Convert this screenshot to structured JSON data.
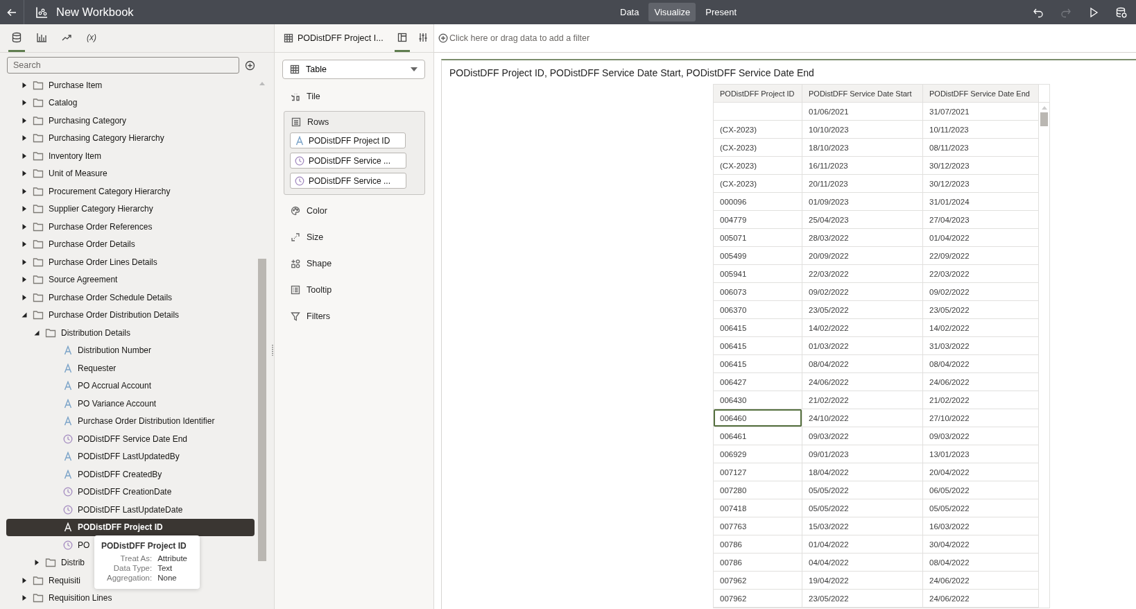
{
  "topbar": {
    "title": "New Workbook",
    "tabs": [
      {
        "label": "Data",
        "selected": false
      },
      {
        "label": "Visualize",
        "selected": true
      },
      {
        "label": "Present",
        "selected": false
      }
    ],
    "actions": [
      {
        "kind": "undo",
        "disabled": false
      },
      {
        "kind": "redo",
        "disabled": true
      },
      {
        "kind": "play",
        "disabled": false
      },
      {
        "kind": "save",
        "disabled": false
      }
    ]
  },
  "data_panel": {
    "tabs": [
      {
        "kind": "data",
        "selected": true
      },
      {
        "kind": "visualizations",
        "selected": false
      },
      {
        "kind": "analytics",
        "selected": false
      },
      {
        "kind": "calculations",
        "label": "(x)",
        "selected": false
      }
    ],
    "search": {
      "placeholder": "Search"
    },
    "tree": [
      {
        "label": "Purchase Item",
        "kind": "folder",
        "expanded": false,
        "selected": false
      },
      {
        "label": "Catalog",
        "kind": "folder",
        "expanded": false,
        "selected": false
      },
      {
        "label": "Purchasing Category",
        "kind": "folder",
        "expanded": false,
        "selected": false
      },
      {
        "label": "Purchasing Category Hierarchy",
        "kind": "folder",
        "expanded": false,
        "selected": false
      },
      {
        "label": "Inventory Item",
        "kind": "folder",
        "expanded": false,
        "selected": false
      },
      {
        "label": "Unit of Measure",
        "kind": "folder",
        "expanded": false,
        "selected": false
      },
      {
        "label": "Procurement Category Hierarchy",
        "kind": "folder",
        "expanded": false,
        "selected": false
      },
      {
        "label": "Supplier Category Hierarchy",
        "kind": "folder",
        "expanded": false,
        "selected": false
      },
      {
        "label": "Purchase Order References",
        "kind": "folder",
        "expanded": false,
        "selected": false
      },
      {
        "label": "Purchase Order Details",
        "kind": "folder",
        "expanded": false,
        "selected": false
      },
      {
        "label": "Purchase Order Lines Details",
        "kind": "folder",
        "expanded": false,
        "selected": false
      },
      {
        "label": "Source Agreement",
        "kind": "folder",
        "expanded": false,
        "selected": false
      },
      {
        "label": "Purchase Order Schedule Details",
        "kind": "folder",
        "expanded": false,
        "selected": false
      },
      {
        "label": "Purchase Order Distribution Details",
        "kind": "folder",
        "expanded": true,
        "selected": false,
        "children": [
          {
            "label": "Distribution Details",
            "kind": "folder",
            "expanded": true,
            "selected": false,
            "children": [
              {
                "label": "Distribution Number",
                "kind": "attribute",
                "selected": false
              },
              {
                "label": "Requester",
                "kind": "attribute",
                "selected": false
              },
              {
                "label": "PO Accrual Account",
                "kind": "attribute",
                "selected": false
              },
              {
                "label": "PO Variance Account",
                "kind": "attribute",
                "selected": false
              },
              {
                "label": "Purchase Order Distribution Identifier",
                "kind": "attribute",
                "selected": false
              },
              {
                "label": "PODistDFF Service Date End",
                "kind": "date",
                "selected": false
              },
              {
                "label": "PODistDFF LastUpdatedBy",
                "kind": "attribute",
                "selected": false
              },
              {
                "label": "PODistDFF CreatedBy",
                "kind": "attribute",
                "selected": false
              },
              {
                "label": "PODistDFF CreationDate",
                "kind": "date",
                "selected": false
              },
              {
                "label": "PODistDFF LastUpdateDate",
                "kind": "date",
                "selected": false
              },
              {
                "label": "PODistDFF Project ID",
                "kind": "attribute",
                "selected": true
              },
              {
                "label": "PO",
                "kind": "date",
                "selected": false
              }
            ]
          },
          {
            "label": "Distrib",
            "kind": "folder",
            "expanded": false,
            "selected": false
          }
        ]
      },
      {
        "label": "Requisiti",
        "kind": "folder",
        "expanded": false,
        "selected": false
      },
      {
        "label": "Requisition Lines",
        "kind": "folder",
        "expanded": false,
        "selected": false
      }
    ],
    "tooltip": {
      "title": "PODistDFF Project ID",
      "fields": [
        {
          "label": "Treat As:",
          "value": "Attribute"
        },
        {
          "label": "Data Type:",
          "value": "Text"
        },
        {
          "label": "Aggregation:",
          "value": "None"
        }
      ]
    }
  },
  "grammar_panel": {
    "title": "PODistDFF Project I...",
    "tabs": [
      {
        "kind": "grammar",
        "selected": true
      },
      {
        "kind": "properties",
        "selected": false
      }
    ],
    "viz_type": "Table",
    "sections": [
      {
        "kind": "tile",
        "label": "Tile"
      },
      {
        "kind": "rows",
        "label": "Rows",
        "items": [
          {
            "label": "PODistDFF Project ID",
            "kind": "attribute"
          },
          {
            "label": "PODistDFF Service ...",
            "kind": "date"
          },
          {
            "label": "PODistDFF Service ...",
            "kind": "date"
          }
        ]
      },
      {
        "kind": "color",
        "label": "Color"
      },
      {
        "kind": "size",
        "label": "Size"
      },
      {
        "kind": "shape",
        "label": "Shape"
      },
      {
        "kind": "tooltip",
        "label": "Tooltip"
      },
      {
        "kind": "filters",
        "label": "Filters"
      }
    ]
  },
  "filter_bar": {
    "placeholder": "Click here or drag data to add a filter"
  },
  "canvas": {
    "title": "PODistDFF Project ID, PODistDFF Service Date Start, PODistDFF Service Date End",
    "table": {
      "columns": [
        "PODistDFF Project ID",
        "PODistDFF Service Date Start",
        "PODistDFF Service Date End"
      ],
      "rows": [
        {
          "cells": [
            "",
            "01/06/2021",
            "31/07/2021"
          ],
          "focused": false
        },
        {
          "cells": [
            "(CX-2023)",
            "10/10/2023",
            "10/11/2023"
          ],
          "focused": false
        },
        {
          "cells": [
            "(CX-2023)",
            "18/10/2023",
            "08/11/2023"
          ],
          "focused": false
        },
        {
          "cells": [
            "(CX-2023)",
            "16/11/2023",
            "30/12/2023"
          ],
          "focused": false
        },
        {
          "cells": [
            "(CX-2023)",
            "20/11/2023",
            "30/12/2023"
          ],
          "focused": false
        },
        {
          "cells": [
            "000096",
            "01/09/2023",
            "31/01/2024"
          ],
          "focused": false
        },
        {
          "cells": [
            "004779",
            "25/04/2023",
            "27/04/2023"
          ],
          "focused": false
        },
        {
          "cells": [
            "005071",
            "28/03/2022",
            "01/04/2022"
          ],
          "focused": false
        },
        {
          "cells": [
            "005499",
            "20/09/2022",
            "22/09/2022"
          ],
          "focused": false
        },
        {
          "cells": [
            "005941",
            "22/03/2022",
            "22/03/2022"
          ],
          "focused": false
        },
        {
          "cells": [
            "006073",
            "09/02/2022",
            "09/02/2022"
          ],
          "focused": false
        },
        {
          "cells": [
            "006370",
            "23/05/2022",
            "23/05/2022"
          ],
          "focused": false
        },
        {
          "cells": [
            "006415",
            "14/02/2022",
            "14/02/2022"
          ],
          "focused": false
        },
        {
          "cells": [
            "006415",
            "01/03/2022",
            "31/03/2022"
          ],
          "focused": false
        },
        {
          "cells": [
            "006415",
            "08/04/2022",
            "08/04/2022"
          ],
          "focused": false
        },
        {
          "cells": [
            "006427",
            "24/06/2022",
            "24/06/2022"
          ],
          "focused": false
        },
        {
          "cells": [
            "006430",
            "21/02/2022",
            "21/02/2022"
          ],
          "focused": false
        },
        {
          "cells": [
            "006460",
            "24/10/2022",
            "27/10/2022"
          ],
          "focused": true
        },
        {
          "cells": [
            "006461",
            "09/03/2022",
            "09/03/2022"
          ],
          "focused": false
        },
        {
          "cells": [
            "006929",
            "09/01/2023",
            "13/01/2023"
          ],
          "focused": false
        },
        {
          "cells": [
            "007127",
            "18/04/2022",
            "20/04/2022"
          ],
          "focused": false
        },
        {
          "cells": [
            "007280",
            "05/05/2022",
            "06/05/2022"
          ],
          "focused": false
        },
        {
          "cells": [
            "007418",
            "05/05/2022",
            "05/05/2022"
          ],
          "focused": false
        },
        {
          "cells": [
            "007763",
            "15/03/2022",
            "16/03/2022"
          ],
          "focused": false
        },
        {
          "cells": [
            "00786",
            "01/04/2022",
            "30/04/2022"
          ],
          "focused": false
        },
        {
          "cells": [
            "00786",
            "04/04/2022",
            "08/04/2022"
          ],
          "focused": false
        },
        {
          "cells": [
            "007962",
            "19/04/2022",
            "24/06/2022"
          ],
          "focused": false
        },
        {
          "cells": [
            "007962",
            "23/05/2022",
            "24/06/2022"
          ],
          "focused": false
        }
      ]
    }
  }
}
